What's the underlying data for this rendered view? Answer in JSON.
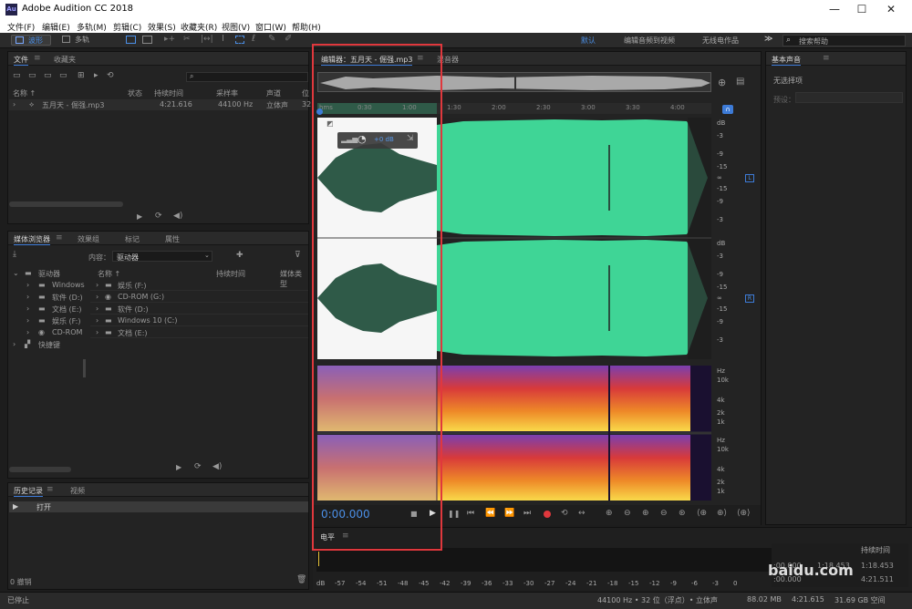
{
  "window": {
    "title": "Adobe Audition CC 2018",
    "app_icon_text": "Au",
    "minimize": "—",
    "maximize": "☐",
    "close": "✕"
  },
  "menu": [
    "文件(F)",
    "编辑(E)",
    "多轨(M)",
    "剪辑(C)",
    "效果(S)",
    "收藏夹(R)",
    "视图(V)",
    "窗口(W)",
    "帮助(H)"
  ],
  "toolbar": {
    "waveform_label": "波形",
    "multitrack_label": "多轨",
    "workspaces": [
      "默认",
      "编辑音频到视频",
      "无线电作品"
    ],
    "search_placeholder": "搜索帮助",
    "more": "≫"
  },
  "files_panel": {
    "tabs": [
      "文件",
      "收藏夹"
    ],
    "columns": [
      "名称 ↑",
      "状态",
      "持续时间",
      "采样率",
      "声道",
      "位"
    ],
    "file": {
      "name": "五月天 - 倔强.mp3",
      "duration": "4:21.616",
      "sample_rate": "44100 Hz",
      "channels": "立体声",
      "bits": "32"
    }
  },
  "media_panel": {
    "tabs": [
      "媒体浏览器",
      "效果组",
      "标记",
      "属性"
    ],
    "content_label": "内容：",
    "content_value": "驱动器",
    "tree_root": "驱动器",
    "left_tree": [
      "Windows",
      "软件 (D:)",
      "文档 (E:)",
      "娱乐 (F:)",
      "CD-ROM"
    ],
    "shortcuts": "快捷键",
    "columns": [
      "名称 ↑",
      "持续时间",
      "媒体类型"
    ],
    "right_list": [
      "娱乐 (F:)",
      "CD-ROM (G:)",
      "软件 (D:)",
      "Windows 10 (C:)",
      "文档 (E:)"
    ]
  },
  "history_panel": {
    "tabs": [
      "历史记录",
      "视频"
    ],
    "item": "打开",
    "undo": "0 撤销"
  },
  "editor": {
    "tabs": [
      "编辑器：五月天 - 倔强.mp3",
      "混音器"
    ],
    "ruler_labels": [
      "hms",
      "0:30",
      "1:00",
      "1:30",
      "2:00",
      "2:30",
      "3:00",
      "3:30",
      "4:00"
    ],
    "db_scale": [
      "dB",
      "-3",
      "-9",
      "-15",
      "∞",
      "-15",
      "-9",
      "-3"
    ],
    "hz_scale": [
      "Hz",
      "10k",
      "4k",
      "2k",
      "1k"
    ],
    "hud_value": "+0 dB",
    "left_channel": "L",
    "right_channel": "R",
    "time": "0:00.000"
  },
  "levels_panel": {
    "title": "电平",
    "scale": [
      "dB",
      "-57",
      "-54",
      "-51",
      "-48",
      "-45",
      "-42",
      "-39",
      "-36",
      "-33",
      "-30",
      "-27",
      "-24",
      "-21",
      "-18",
      "-15",
      "-12",
      "-9",
      "-6",
      "-3",
      "0"
    ]
  },
  "essential_sound": {
    "title": "基本声音",
    "no_selection": "无选择项",
    "preset_label": "预设："
  },
  "selection_panel": {
    "header": "持续时间",
    "values": [
      ":00.000",
      "1:18.453",
      "1:18.453",
      ":00.000",
      "4:21.511"
    ]
  },
  "status_bar": {
    "left": "已停止",
    "items": [
      "44100 Hz • 32 位（浮点）• 立体声",
      "88.02 MB",
      "4:21.615",
      "31.69 GB 空间"
    ]
  },
  "watermark": "baidu.com",
  "colors": {
    "waveform": "#3fd596",
    "waveform_selected": "#2f5a48",
    "accent_blue": "#3d7bd7",
    "playhead": "#e0383d"
  }
}
